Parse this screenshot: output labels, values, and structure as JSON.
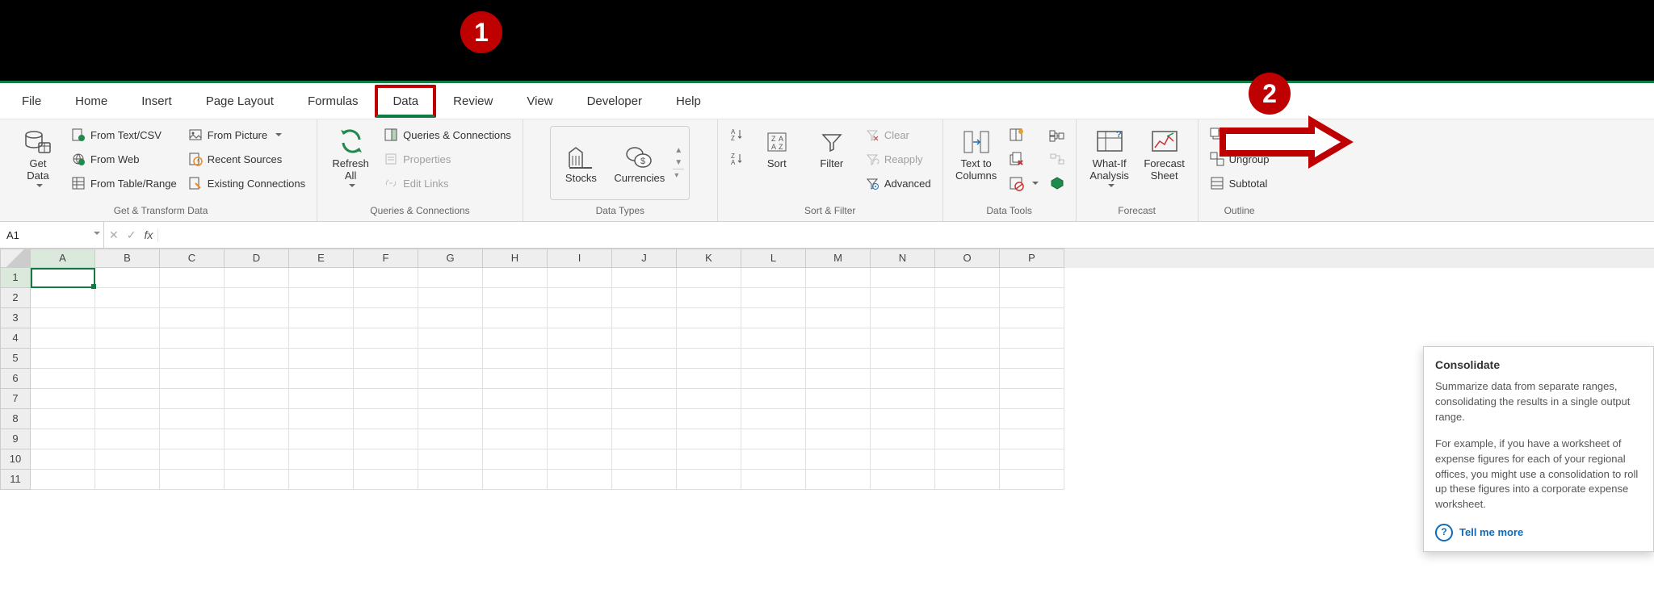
{
  "tabs": [
    "File",
    "Home",
    "Insert",
    "Page Layout",
    "Formulas",
    "Data",
    "Review",
    "View",
    "Developer",
    "Help"
  ],
  "active_tab": "Data",
  "groups": {
    "gt": {
      "label": "Get & Transform Data",
      "getdata": "Get\nData",
      "items": [
        "From Text/CSV",
        "From Web",
        "From Table/Range",
        "From Picture",
        "Recent Sources",
        "Existing Connections"
      ]
    },
    "qc": {
      "label": "Queries & Connections",
      "refresh": "Refresh\nAll",
      "items": [
        "Queries & Connections",
        "Properties",
        "Edit Links"
      ]
    },
    "dt": {
      "label": "Data Types",
      "items": [
        "Stocks",
        "Currencies"
      ]
    },
    "sf": {
      "label": "Sort & Filter",
      "sort": "Sort",
      "filter": "Filter",
      "items": [
        "Clear",
        "Reapply",
        "Advanced"
      ]
    },
    "dtool": {
      "label": "Data Tools",
      "ttc": "Text to\nColumns"
    },
    "fc": {
      "label": "Forecast",
      "wia": "What-If\nAnalysis",
      "fs": "Forecast\nSheet"
    },
    "ol": {
      "label": "Outline",
      "items": [
        "Group",
        "Ungroup",
        "Subtotal"
      ]
    }
  },
  "namebox": "A1",
  "columns": [
    "A",
    "B",
    "C",
    "D",
    "E",
    "F",
    "G",
    "H",
    "I",
    "J",
    "K",
    "L",
    "M",
    "N",
    "O",
    "P"
  ],
  "rows": [
    1,
    2,
    3,
    4,
    5,
    6,
    7,
    8,
    9,
    10,
    11
  ],
  "tooltip": {
    "title": "Consolidate",
    "p1": "Summarize data from separate ranges, consolidating the results in a single output range.",
    "p2": "For example, if you have a worksheet of expense figures for each of your regional offices, you might use a consolidation to roll up these figures into a corporate expense worksheet.",
    "more": "Tell me more"
  },
  "badge1": "1",
  "badge2": "2"
}
